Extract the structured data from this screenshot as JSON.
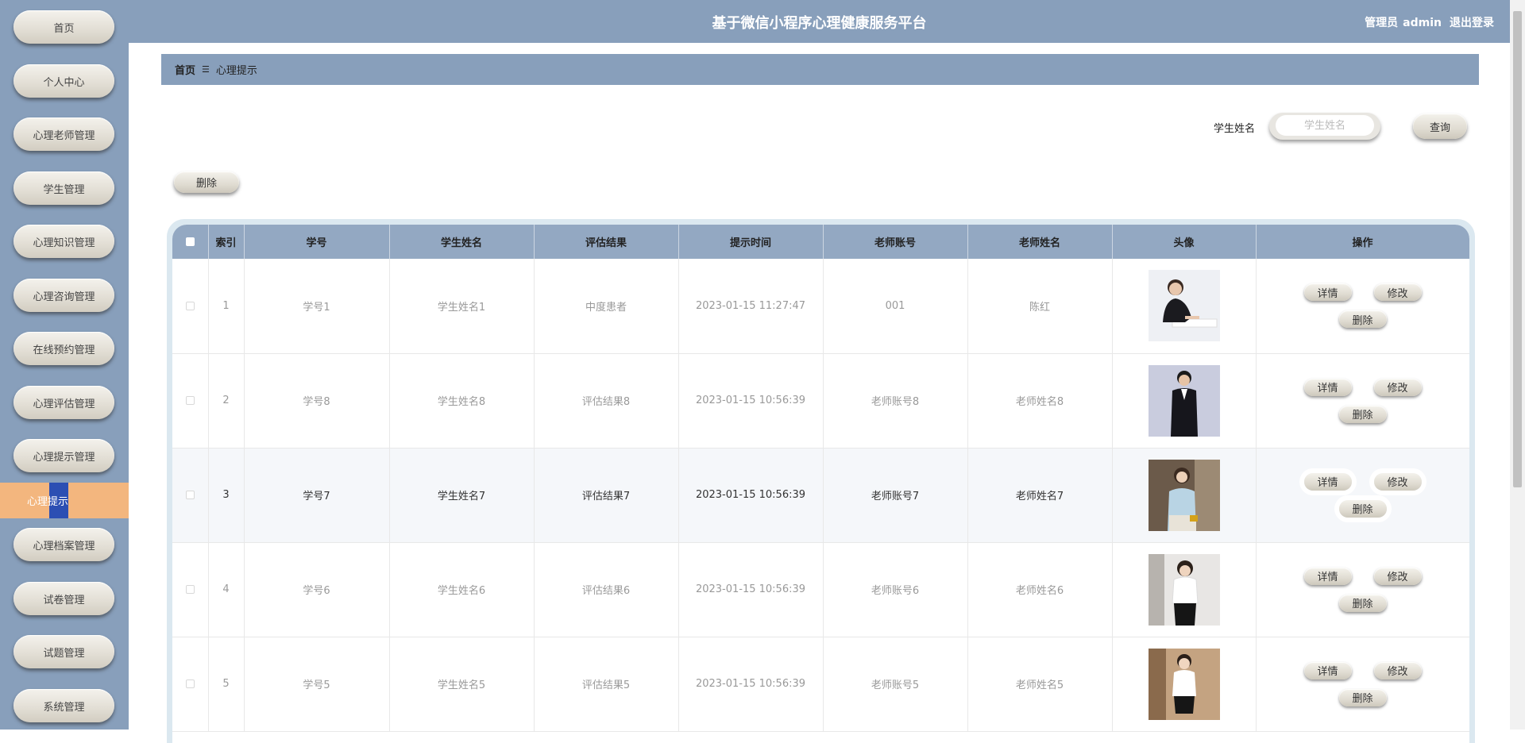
{
  "header": {
    "title": "基于微信小程序心理健康服务平台",
    "user_role": "管理员",
    "user_name": "admin",
    "logout": "退出登录"
  },
  "sidebar": {
    "items": [
      {
        "label": "首页"
      },
      {
        "label": "个人中心"
      },
      {
        "label": "心理老师管理"
      },
      {
        "label": "学生管理"
      },
      {
        "label": "心理知识管理"
      },
      {
        "label": "心理咨询管理"
      },
      {
        "label": "在线预约管理"
      },
      {
        "label": "心理评估管理"
      },
      {
        "label": "心理提示管理"
      },
      {
        "label": "心理档案管理"
      },
      {
        "label": "试卷管理"
      },
      {
        "label": "试题管理"
      },
      {
        "label": "系统管理"
      }
    ],
    "active_sub": "心理提示"
  },
  "breadcrumb": {
    "home": "首页",
    "separator": "☰",
    "current": "心理提示"
  },
  "search": {
    "label": "学生姓名",
    "placeholder": "学生姓名",
    "button": "查询"
  },
  "toolbar": {
    "delete_label": "删除"
  },
  "table": {
    "columns": [
      "索引",
      "学号",
      "学生姓名",
      "评估结果",
      "提示时间",
      "老师账号",
      "老师姓名",
      "头像",
      "操作"
    ],
    "rows": [
      {
        "index": "1",
        "student_no": "学号1",
        "student_name": "学生姓名1",
        "result": "中度患者",
        "time": "2023-01-15 11:27:47",
        "teacher_account": "001",
        "teacher_name": "陈红"
      },
      {
        "index": "2",
        "student_no": "学号8",
        "student_name": "学生姓名8",
        "result": "评估结果8",
        "time": "2023-01-15 10:56:39",
        "teacher_account": "老师账号8",
        "teacher_name": "老师姓名8"
      },
      {
        "index": "3",
        "student_no": "学号7",
        "student_name": "学生姓名7",
        "result": "评估结果7",
        "time": "2023-01-15 10:56:39",
        "teacher_account": "老师账号7",
        "teacher_name": "老师姓名7"
      },
      {
        "index": "4",
        "student_no": "学号6",
        "student_name": "学生姓名6",
        "result": "评估结果6",
        "time": "2023-01-15 10:56:39",
        "teacher_account": "老师账号6",
        "teacher_name": "老师姓名6"
      },
      {
        "index": "5",
        "student_no": "学号5",
        "student_name": "学生姓名5",
        "result": "评估结果5",
        "time": "2023-01-15 10:56:39",
        "teacher_account": "老师账号5",
        "teacher_name": "老师姓名5"
      }
    ],
    "actions": {
      "detail": "详情",
      "edit": "修改",
      "delete": "删除"
    }
  },
  "colors": {
    "sidebar_bg": "#889fbb",
    "header_bg": "#889fbb",
    "active_sub_bg": "#f3b67e",
    "table_head_bg": "#93a8c2"
  }
}
